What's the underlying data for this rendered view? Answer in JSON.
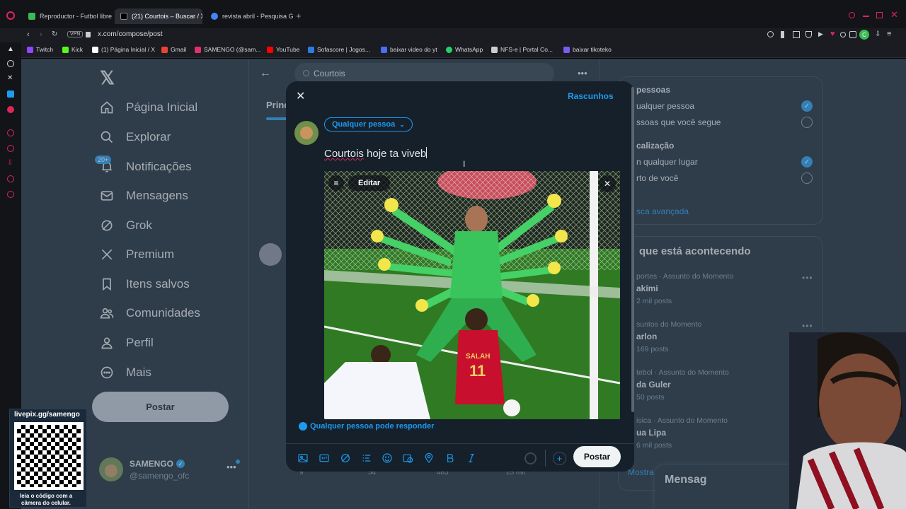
{
  "browser": {
    "tabs": [
      {
        "label": "Reproductor - Futbol libre",
        "color": "#3cba54"
      },
      {
        "label": "(21) Courtois – Buscar / X",
        "color": "#000000"
      },
      {
        "label": "revista abril - Pesquisa G…",
        "color": "#4285f4"
      }
    ],
    "url": "x.com/compose/post",
    "vpn_label": "VPN",
    "bookmarks": [
      {
        "label": "Twitch",
        "color": "#9146ff"
      },
      {
        "label": "Kick",
        "color": "#53fc18"
      },
      {
        "label": "(1) Página Inicial / X",
        "color": "#ffffff"
      },
      {
        "label": "Gmail",
        "color": "#ea4335"
      },
      {
        "label": "SAMENGO (@sam...",
        "color": "#e1306c"
      },
      {
        "label": "YouTube",
        "color": "#ff0000"
      },
      {
        "label": "Sofascore | Jogos...",
        "color": "#2c7be5"
      },
      {
        "label": "baixar video do yt",
        "color": "#4a6cf7"
      },
      {
        "label": "WhatsApp",
        "color": "#25d366"
      },
      {
        "label": "NFS-e | Portal Co...",
        "color": "#cccccc"
      },
      {
        "label": "baixar tikoteko",
        "color": "#7b5cf0"
      }
    ]
  },
  "sidebar": {
    "nav": [
      {
        "label": "Página Inicial",
        "icon": "home-icon"
      },
      {
        "label": "Explorar",
        "icon": "search-icon"
      },
      {
        "label": "Notificações",
        "icon": "bell-icon",
        "badge": "20+"
      },
      {
        "label": "Mensagens",
        "icon": "mail-icon"
      },
      {
        "label": "Grok",
        "icon": "grok-icon"
      },
      {
        "label": "Premium",
        "icon": "x-logo-icon"
      },
      {
        "label": "Itens salvos",
        "icon": "bookmark-icon"
      },
      {
        "label": "Comunidades",
        "icon": "people-icon"
      },
      {
        "label": "Perfil",
        "icon": "person-icon"
      },
      {
        "label": "Mais",
        "icon": "more-circle-icon"
      }
    ],
    "post_label": "Postar",
    "account": {
      "name": "SAMENGO",
      "handle": "@samengo_ofc"
    }
  },
  "search": {
    "value": "Courtois",
    "tab_partial": "Princ"
  },
  "right": {
    "filters_title": "pessoas",
    "people_any": "ualquer pessoa",
    "people_follow": "ssoas que você segue",
    "location_title": "calização",
    "loc_any": "n qualquer lugar",
    "loc_near": "rto de você",
    "advanced": "sca avançada",
    "trending_title": "que está acontecendo",
    "trends": [
      {
        "meta": "portes · Assunto do Momento",
        "title": "akimi",
        "count": "2 mil posts"
      },
      {
        "meta": "suntos do Momento",
        "title": "arlon",
        "count": "169 posts"
      },
      {
        "meta": "tebol · Assunto do Momento",
        "title": "da Guler",
        "count": "50 posts"
      },
      {
        "meta": "isica · Assunto do Momento",
        "title": "ua Lipa",
        "count": "6 mil posts"
      }
    ],
    "show_more": "Mostra",
    "messages": "Mensag"
  },
  "compose": {
    "drafts_label": "Rascunhos",
    "audience": "Qualquer pessoa",
    "text_word": "Courtois",
    "text_rest": " hoje ta viveb",
    "edit_label": "Editar",
    "reply_setting": "Qualquer pessoa pode responder",
    "post_label": "Postar"
  },
  "behind_stats": {
    "replies": "9",
    "reposts": "54",
    "likes": "483",
    "views": "25 mil"
  },
  "overlay": {
    "qr_title": "livepix.gg/samengo",
    "qr_caption_1": "leia o código com a",
    "qr_caption_2": "câmera do celular."
  }
}
